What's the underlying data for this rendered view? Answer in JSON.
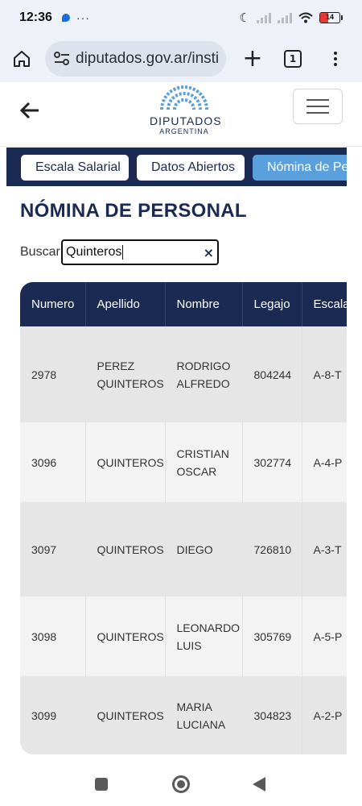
{
  "status_bar": {
    "time": "12:36",
    "more": "···",
    "battery": "14",
    "colors": {
      "battery_low": "#e53935",
      "message_icon": "#1a6fd6"
    }
  },
  "browser": {
    "url": "diputados.gov.ar/insti",
    "tab_count": "1",
    "new_tab": "+"
  },
  "site": {
    "logo_title": "DIPUTADOS",
    "logo_subtitle": "ARGENTINA"
  },
  "tabs": [
    {
      "label": "Escala Salarial"
    },
    {
      "label": "Datos Abiertos"
    },
    {
      "label": "Nómina de Pe"
    }
  ],
  "page": {
    "title": "NÓMINA DE PERSONAL",
    "search_label": "Buscar:",
    "search_value": "Quinteros",
    "clear_icon": "×"
  },
  "table": {
    "headers": [
      "Numero",
      "Apellido",
      "Nombre",
      "Legajo",
      "Escala"
    ],
    "rows": [
      {
        "numero": "2978",
        "apellido_1": "PEREZ",
        "apellido_2": "QUINTEROS",
        "nombre_1": "RODRIGO",
        "nombre_2": "ALFREDO",
        "legajo": "804244",
        "escala": "A-8-T"
      },
      {
        "numero": "3096",
        "apellido_1": "QUINTEROS",
        "apellido_2": "",
        "nombre_1": "CRISTIAN",
        "nombre_2": "OSCAR",
        "legajo": "302774",
        "escala": "A-4-P"
      },
      {
        "numero": "3097",
        "apellido_1": "QUINTEROS",
        "apellido_2": "",
        "nombre_1": "DIEGO",
        "nombre_2": "",
        "legajo": "726810",
        "escala": "A-3-T"
      },
      {
        "numero": "3098",
        "apellido_1": "QUINTEROS",
        "apellido_2": "",
        "nombre_1": "LEONARDO",
        "nombre_2": "LUIS",
        "legajo": "305769",
        "escala": "A-5-P"
      },
      {
        "numero": "3099",
        "apellido_1": "QUINTEROS",
        "apellido_2": "",
        "nombre_1": "MARIA",
        "nombre_2": "LUCIANA",
        "legajo": "304823",
        "escala": "A-2-P"
      }
    ]
  },
  "colors": {
    "navy": "#1b2a52",
    "active_tab": "#5aa0dd",
    "row_odd": "#e6e6e6",
    "row_even": "#f3f3f3"
  }
}
